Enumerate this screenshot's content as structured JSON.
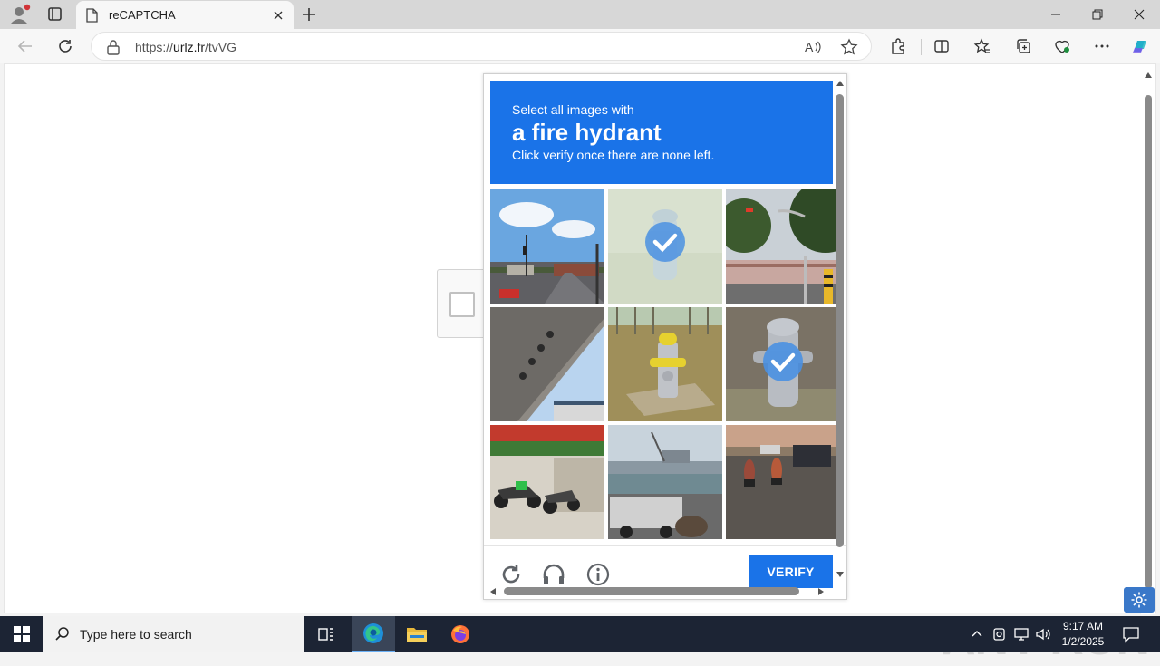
{
  "browser": {
    "tab_title": "reCAPTCHA",
    "url_domain": "urlz.fr",
    "url_prefix": "https://",
    "url_path": "/tvVG"
  },
  "captcha": {
    "instruction_line1": "Select all images with",
    "target_object": "a fire hydrant",
    "instruction_line3": "Click verify once there are none left.",
    "verify_label": "VERIFY",
    "tiles": [
      {
        "scene": "street-with-traffic-lights",
        "selected": false
      },
      {
        "scene": "fire-hydrant-faded",
        "selected": true
      },
      {
        "scene": "traffic-light-pole",
        "selected": false
      },
      {
        "scene": "overpass-underside",
        "selected": false
      },
      {
        "scene": "yellow-silver-fire-hydrant",
        "selected": false
      },
      {
        "scene": "silver-fire-hydrant",
        "selected": true
      },
      {
        "scene": "parked-motorcycles",
        "selected": false
      },
      {
        "scene": "harbor-with-truck",
        "selected": false
      },
      {
        "scene": "street-with-motorbikes",
        "selected": false
      }
    ],
    "accent_color": "#1a73e8"
  },
  "watermark": "ANY RUN",
  "taskbar": {
    "search_placeholder": "Type here to search",
    "time": "9:17 AM",
    "date": "1/2/2025"
  }
}
